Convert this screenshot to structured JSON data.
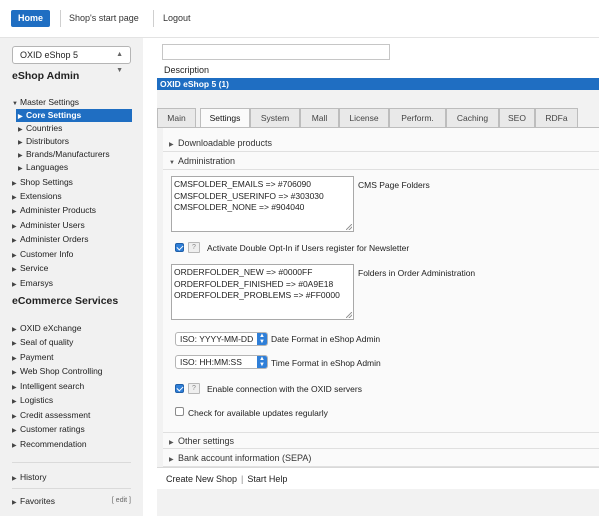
{
  "topbar": {
    "home_label": "Home",
    "shop_start_label": "Shop's start page",
    "logout_label": "Logout"
  },
  "sidebar": {
    "shop_select_value": "OXID eShop 5",
    "admin_heading": "eShop Admin",
    "master_settings": "Master Settings",
    "core_settings": "Core Settings",
    "master_sub": [
      "Countries",
      "Distributors",
      "Brands/Manufacturers",
      "Languages"
    ],
    "groups": [
      "Shop Settings",
      "Extensions",
      "Administer Products",
      "Administer Users",
      "Administer Orders",
      "Customer Info",
      "Service",
      "Emarsys"
    ],
    "services_heading": "eCommerce Services",
    "services": [
      "OXID eXchange",
      "Seal of quality",
      "Payment",
      "Web Shop Controlling",
      "Intelligent search",
      "Logistics",
      "Credit assessment",
      "Customer ratings",
      "Recommendation"
    ],
    "history_label": "History",
    "favorites_label": "Favorites",
    "edit_label": "[ edit ]"
  },
  "main": {
    "description_label": "Description",
    "title_bar": "OXID eShop 5 (1)",
    "tabs": [
      "Main",
      "Settings",
      "System",
      "Mall",
      "License",
      "Perform.",
      "Caching",
      "SEO",
      "RDFa"
    ],
    "active_tab": "Settings",
    "sections": {
      "downloadable": "Downloadable products",
      "administration": "Administration",
      "other": "Other settings",
      "bank": "Bank account information (SEPA)"
    },
    "cms_folders_text": "CMSFOLDER_EMAILS => #706090\nCMSFOLDER_USERINFO => #303030\nCMSFOLDER_NONE => #904040",
    "cms_folders_label": "CMS Page Folders",
    "double_optin_label": "Activate Double Opt-In if Users register for Newsletter",
    "order_folders_text": "ORDERFOLDER_NEW => #0000FF\nORDERFOLDER_FINISHED => #0A9E18\nORDERFOLDER_PROBLEMS => #FF0000",
    "order_folders_label": "Folders in Order Administration",
    "date_format_value": "ISO: YYYY-MM-DD",
    "date_format_label": "Date Format in eShop Admin",
    "time_format_value": "ISO: HH:MM:SS",
    "time_format_label": "Time Format in eShop Admin",
    "oxid_servers_label": "Enable connection with the OXID servers",
    "updates_label": "Check for available updates regularly",
    "help_glyph": "?",
    "checks": {
      "double_optin": true,
      "oxid_servers": true,
      "updates": false
    }
  },
  "footer": {
    "create_shop": "Create New Shop",
    "separator": "|",
    "start_help": "Start Help"
  },
  "colors": {
    "accent": "#1f6ec2",
    "panel_bg": "#f2f2f2",
    "sidebar_bg": "#f1f1f1"
  }
}
